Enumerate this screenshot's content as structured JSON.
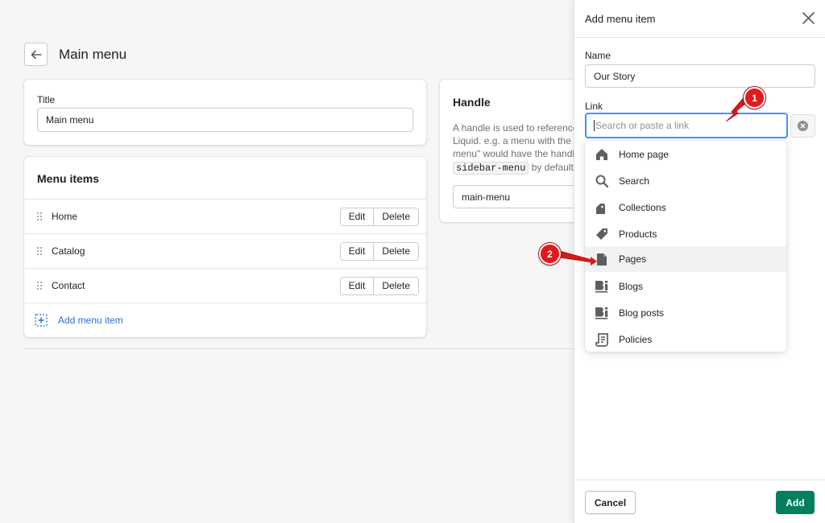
{
  "header": {
    "title": "Main menu"
  },
  "title_card": {
    "label": "Title",
    "value": "Main menu"
  },
  "menu_card": {
    "heading": "Menu items",
    "items": [
      {
        "label": "Home"
      },
      {
        "label": "Catalog"
      },
      {
        "label": "Contact"
      }
    ],
    "edit_label": "Edit",
    "delete_label": "Delete",
    "add_label": "Add menu item"
  },
  "handle_card": {
    "title": "Handle",
    "desc_line1": "A handle is used to reference",
    "desc_line2": "Liquid. e.g. a menu with the ti",
    "desc_line3": "menu\" would have the handle",
    "desc_code": "sidebar-menu",
    "desc_after": " by default.",
    "value": "main-menu"
  },
  "drawer": {
    "title": "Add menu item",
    "name_label": "Name",
    "name_value": "Our Story",
    "link_label": "Link",
    "link_placeholder": "Search or paste a link",
    "cancel_label": "Cancel",
    "add_label": "Add"
  },
  "dropdown": {
    "items": [
      {
        "label": "Home page",
        "icon": "home-icon"
      },
      {
        "label": "Search",
        "icon": "search-icon"
      },
      {
        "label": "Collections",
        "icon": "collections-icon"
      },
      {
        "label": "Products",
        "icon": "tag-icon"
      },
      {
        "label": "Pages",
        "icon": "page-icon"
      },
      {
        "label": "Blogs",
        "icon": "blog-icon"
      },
      {
        "label": "Blog posts",
        "icon": "blog-post-icon"
      },
      {
        "label": "Policies",
        "icon": "policy-icon"
      }
    ]
  },
  "annotations": {
    "badge1": "1",
    "badge2": "2"
  },
  "colors": {
    "primary": "#008060",
    "focus": "#458fff",
    "link": "#2c6ecb",
    "annotation": "#e3191b"
  }
}
